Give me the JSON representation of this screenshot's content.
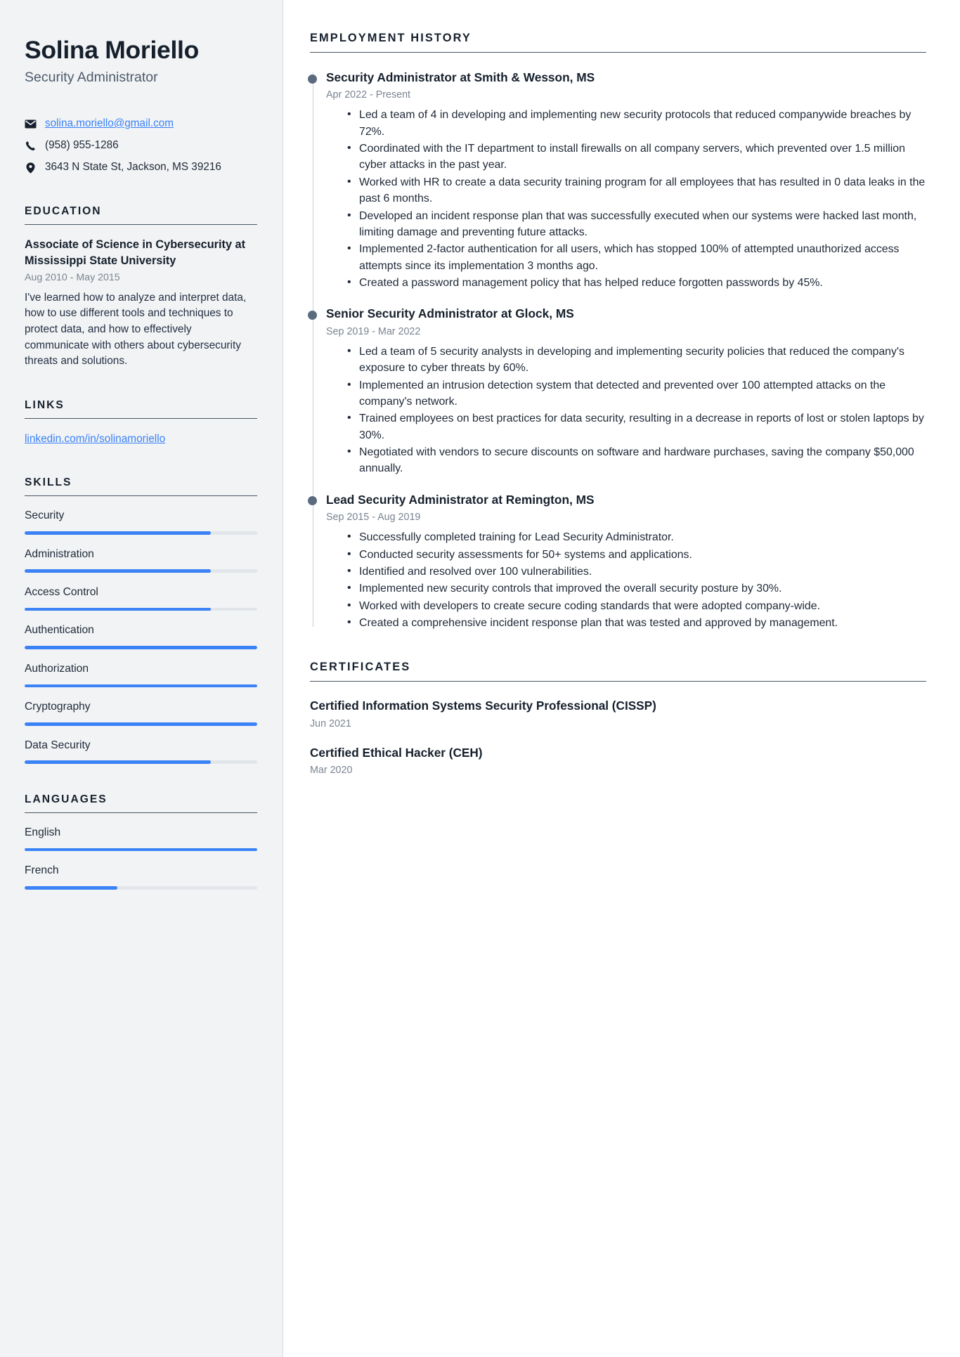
{
  "accent_color": "#3b82f6",
  "heading_color": "#16202c",
  "sidebar_background": "#f1f3f5",
  "header": {
    "name": "Solina Moriello",
    "job_title": "Security Administrator"
  },
  "contact": {
    "email": "solina.moriello@gmail.com",
    "phone": "(958) 955-1286",
    "address": "3643 N State St, Jackson, MS 39216",
    "email_icon": "envelope-icon",
    "phone_icon": "phone-icon",
    "address_icon": "location-pin-icon"
  },
  "education": {
    "heading": "EDUCATION",
    "degree": "Associate of Science in Cybersecurity at Mississippi State University",
    "dates": "Aug 2010 - May 2015",
    "description": "I've learned how to analyze and interpret data, how to use different tools and techniques to protect data, and how to effectively communicate with others about cybersecurity threats and solutions."
  },
  "links": {
    "heading": "LINKS",
    "items": [
      {
        "label": "linkedin.com/in/solinamoriello"
      }
    ]
  },
  "skills": {
    "heading": "SKILLS",
    "items": [
      {
        "label": "Security",
        "level": 80
      },
      {
        "label": "Administration",
        "level": 80
      },
      {
        "label": "Access Control",
        "level": 80
      },
      {
        "label": "Authentication",
        "level": 100
      },
      {
        "label": "Authorization",
        "level": 100
      },
      {
        "label": "Cryptography",
        "level": 100
      },
      {
        "label": "Data Security",
        "level": 80
      }
    ]
  },
  "languages": {
    "heading": "LANGUAGES",
    "items": [
      {
        "label": "English",
        "level": 100
      },
      {
        "label": "French",
        "level": 40
      }
    ]
  },
  "employment": {
    "heading": "EMPLOYMENT HISTORY",
    "jobs": [
      {
        "title": "Security Administrator at Smith & Wesson, MS",
        "dates": "Apr 2022 - Present",
        "bullets": [
          "Led a team of 4 in developing and implementing new security protocols that reduced companywide breaches by 72%.",
          "Coordinated with the IT department to install firewalls on all company servers, which prevented over 1.5 million cyber attacks in the past year.",
          "Worked with HR to create a data security training program for all employees that has resulted in 0 data leaks in the past 6 months.",
          "Developed an incident response plan that was successfully executed when our systems were hacked last month, limiting damage and preventing future attacks.",
          "Implemented 2-factor authentication for all users, which has stopped 100% of attempted unauthorized access attempts since its implementation 3 months ago.",
          "Created a password management policy that has helped reduce forgotten passwords by 45%."
        ]
      },
      {
        "title": "Senior Security Administrator at Glock, MS",
        "dates": "Sep 2019 - Mar 2022",
        "bullets": [
          "Led a team of 5 security analysts in developing and implementing security policies that reduced the company's exposure to cyber threats by 60%.",
          "Implemented an intrusion detection system that detected and prevented over 100 attempted attacks on the company's network.",
          "Trained employees on best practices for data security, resulting in a decrease in reports of lost or stolen laptops by 30%.",
          "Negotiated with vendors to secure discounts on software and hardware purchases, saving the company $50,000 annually."
        ]
      },
      {
        "title": "Lead Security Administrator at Remington, MS",
        "dates": "Sep 2015 - Aug 2019",
        "bullets": [
          "Successfully completed training for Lead Security Administrator.",
          "Conducted security assessments for 50+ systems and applications.",
          "Identified and resolved over 100 vulnerabilities.",
          "Implemented new security controls that improved the overall security posture by 30%.",
          "Worked with developers to create secure coding standards that were adopted company-wide.",
          "Created a comprehensive incident response plan that was tested and approved by management."
        ]
      }
    ]
  },
  "certificates": {
    "heading": "CERTIFICATES",
    "items": [
      {
        "name": "Certified Information Systems Security Professional (CISSP)",
        "date": "Jun 2021"
      },
      {
        "name": "Certified Ethical Hacker (CEH)",
        "date": "Mar 2020"
      }
    ]
  }
}
